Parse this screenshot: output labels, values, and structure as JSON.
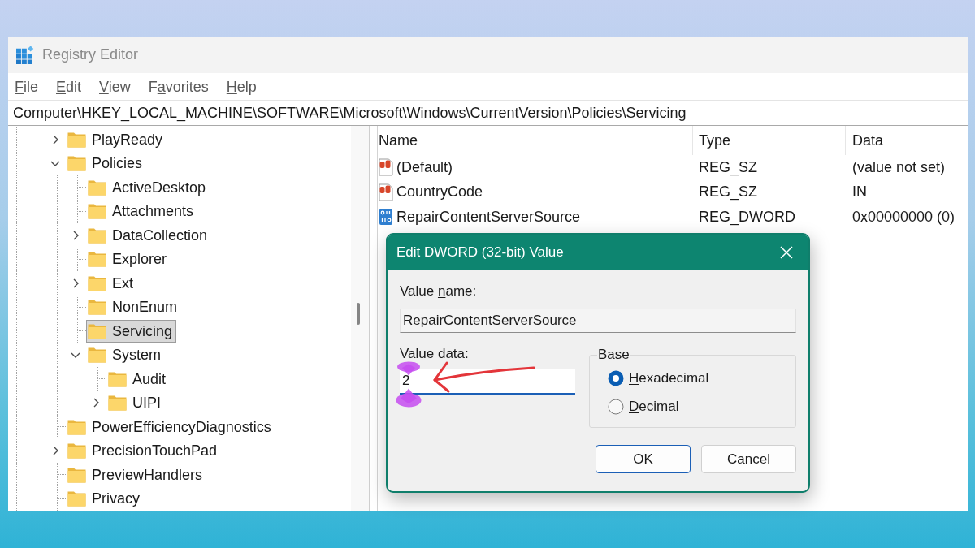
{
  "window": {
    "title": "Registry Editor"
  },
  "menu": [
    {
      "key": "F",
      "post": "ile"
    },
    {
      "key": "E",
      "post": "dit"
    },
    {
      "key": "V",
      "post": "iew"
    },
    {
      "pre": "F",
      "key": "a",
      "post": "vorites"
    },
    {
      "key": "H",
      "post": "elp"
    }
  ],
  "address_bar": {
    "path": "Computer\\HKEY_LOCAL_MACHINE\\SOFTWARE\\Microsoft\\Windows\\CurrentVersion\\Policies\\Servicing"
  },
  "tree": [
    {
      "label": "PlayReady",
      "expandable": true,
      "expanded": false,
      "selected": false
    },
    {
      "label": "Policies",
      "expandable": true,
      "expanded": true,
      "selected": false,
      "children": [
        {
          "label": "ActiveDesktop",
          "expandable": false,
          "expanded": false,
          "selected": false
        },
        {
          "label": "Attachments",
          "expandable": false,
          "expanded": false,
          "selected": false
        },
        {
          "label": "DataCollection",
          "expandable": true,
          "expanded": false,
          "selected": false
        },
        {
          "label": "Explorer",
          "expandable": false,
          "expanded": false,
          "selected": false
        },
        {
          "label": "Ext",
          "expandable": true,
          "expanded": false,
          "selected": false
        },
        {
          "label": "NonEnum",
          "expandable": false,
          "expanded": false,
          "selected": false
        },
        {
          "label": "Servicing",
          "expandable": false,
          "expanded": false,
          "selected": true
        },
        {
          "label": "System",
          "expandable": true,
          "expanded": true,
          "selected": false,
          "children": [
            {
              "label": "Audit",
              "expandable": false,
              "expanded": false,
              "selected": false
            },
            {
              "label": "UIPI",
              "expandable": true,
              "expanded": false,
              "selected": false
            }
          ]
        }
      ]
    },
    {
      "label": "PowerEfficiencyDiagnostics",
      "expandable": false,
      "expanded": false,
      "selected": false
    },
    {
      "label": "PrecisionTouchPad",
      "expandable": true,
      "expanded": false,
      "selected": false
    },
    {
      "label": "PreviewHandlers",
      "expandable": false,
      "expanded": false,
      "selected": false
    },
    {
      "label": "Privacy",
      "expandable": false,
      "expanded": false,
      "selected": false
    }
  ],
  "values_table": {
    "columns": [
      "Name",
      "Type",
      "Data"
    ],
    "rows": [
      {
        "kind": "string",
        "name": "(Default)",
        "type": "REG_SZ",
        "data": "(value not set)"
      },
      {
        "kind": "string",
        "name": "CountryCode",
        "type": "REG_SZ",
        "data": "IN"
      },
      {
        "kind": "dword",
        "name": "RepairContentServerSource",
        "type": "REG_DWORD",
        "data": "0x00000000 (0)"
      }
    ]
  },
  "dialog": {
    "title": "Edit DWORD (32-bit) Value",
    "value_name": {
      "label": {
        "pre": "Value ",
        "key": "n",
        "post": "ame:"
      },
      "value": "RepairContentServerSource",
      "readonly": true
    },
    "value_data": {
      "label": {
        "pre": "Value data:"
      },
      "value": "2",
      "focused": true
    },
    "base": {
      "label": "Base",
      "options": [
        {
          "label": {
            "key": "H",
            "post": "exadecimal"
          },
          "selected": true
        },
        {
          "label": {
            "key": "D",
            "post": "ecimal"
          },
          "selected": false
        }
      ]
    },
    "buttons": [
      {
        "label": "OK",
        "default": true
      },
      {
        "label": "Cancel",
        "default": false
      }
    ]
  }
}
